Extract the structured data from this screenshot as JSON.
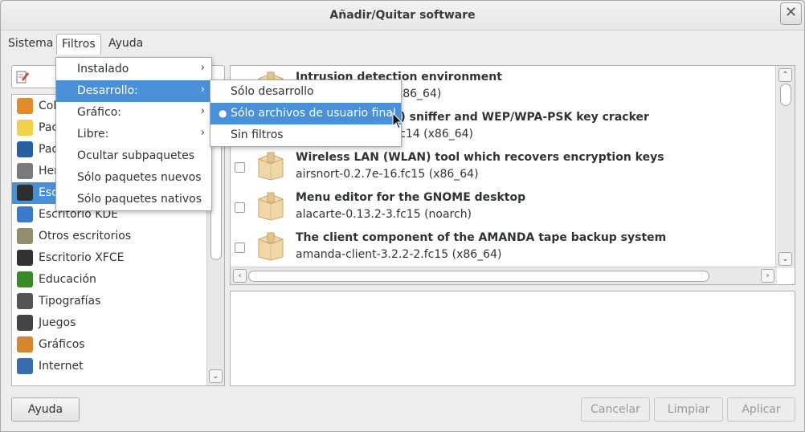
{
  "window": {
    "title": "Añadir/Quitar software"
  },
  "menubar": {
    "items": [
      "Sistema",
      "Filtros",
      "Ayuda"
    ]
  },
  "categories": [
    {
      "label": "Col",
      "icon": "color-palette-icon",
      "color": "#e08a2c"
    },
    {
      "label": "Pac",
      "icon": "lightbulb-icon",
      "color": "#f2d04a"
    },
    {
      "label": "Pac",
      "icon": "magnifier-icon",
      "color": "#2b5fa3"
    },
    {
      "label": "Her",
      "icon": "monitor-clock-icon",
      "color": "#7a7a7a"
    },
    {
      "label": "Esc",
      "icon": "gnome-foot-icon",
      "color": "#2e2e2e"
    },
    {
      "label": "Escritorio KDE",
      "icon": "kde-icon",
      "color": "#3a7ac8"
    },
    {
      "label": "Otros escritorios",
      "icon": "desktop-icon",
      "color": "#8f8f6f"
    },
    {
      "label": "Escritorio XFCE",
      "icon": "xfce-mouse-icon",
      "color": "#333333"
    },
    {
      "label": "Educación",
      "icon": "education-chart-icon",
      "color": "#3a8a2a"
    },
    {
      "label": "Tipografías",
      "icon": "font-icon",
      "color": "#555555"
    },
    {
      "label": "Juegos",
      "icon": "gamepad-icon",
      "color": "#444444"
    },
    {
      "label": "Gráficos",
      "icon": "graphics-brush-icon",
      "color": "#d4872d"
    },
    {
      "label": "Internet",
      "icon": "globe-icon",
      "color": "#3a6db0"
    }
  ],
  "packages": [
    {
      "summary": "Intrusion detection environment",
      "name": "aide-0.14-1.fc15 (x86_64)"
    },
    {
      "summary": "802.11 (wireless) sniffer and WEP/WPA-PSK key cracker",
      "name": "aircrack-ng-1.1-3.fc14 (x86_64)"
    },
    {
      "summary": "Wireless LAN (WLAN) tool which recovers encryption keys",
      "name": "airsnort-0.2.7e-16.fc15 (x86_64)"
    },
    {
      "summary": "Menu editor for the GNOME desktop",
      "name": "alacarte-0.13.2-3.fc15 (noarch)"
    },
    {
      "summary": "The client component of the AMANDA tape backup system",
      "name": "amanda-client-3.2.2-2.fc15 (x86_64)"
    }
  ],
  "filters_menu": [
    {
      "label": "Instalado",
      "submenu": true
    },
    {
      "label": "Desarrollo:",
      "submenu": true
    },
    {
      "label": "Gráfico:",
      "submenu": true
    },
    {
      "label": "Libre:",
      "submenu": true
    },
    {
      "label": "Ocultar subpaquetes",
      "submenu": false
    },
    {
      "label": "Sólo paquetes nuevos",
      "submenu": false
    },
    {
      "label": "Sólo paquetes nativos",
      "submenu": false
    }
  ],
  "development_submenu": [
    {
      "label": "Sólo desarrollo",
      "selected": false
    },
    {
      "label": "Sólo archivos de usuario final",
      "selected": true
    },
    {
      "label": "Sin filtros",
      "selected": false
    }
  ],
  "buttons": {
    "help": "Ayuda",
    "cancel": "Cancelar",
    "clear": "Limpiar",
    "apply": "Aplicar"
  },
  "colors": {
    "highlight": "#4a90d9",
    "window_bg": "#ededed"
  }
}
